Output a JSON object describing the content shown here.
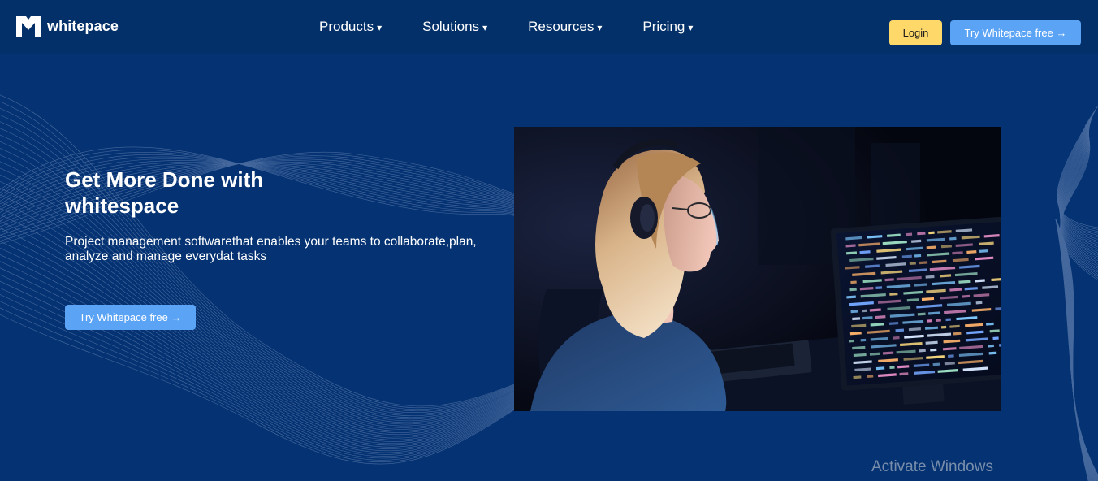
{
  "brand": {
    "name": "whitepace",
    "logo_icon": "whitepace-logo-icon"
  },
  "nav": {
    "items": [
      {
        "label": "Products",
        "caret": "▾"
      },
      {
        "label": "Solutions",
        "caret": "▾"
      },
      {
        "label": "Resources",
        "caret": "▾"
      },
      {
        "label": "Pricing",
        "caret": "▾"
      }
    ],
    "login_label": "Login",
    "try_label": "Try Whitepace free →"
  },
  "hero": {
    "title": "Get More Done with whitespace",
    "subtitle": "Project management softwarethat enables your teams to collaborate,plan, analyze and manage everydat tasks",
    "cta_label": "Try Whitepace free →",
    "image": "woman-with-headphones-coding-at-monitor"
  },
  "system": {
    "watermark": "Activate Windows"
  },
  "colors": {
    "background": "#043272",
    "navbar": "#033068",
    "login_button": "#ffd86a",
    "primary_button": "#5aa3f5"
  }
}
